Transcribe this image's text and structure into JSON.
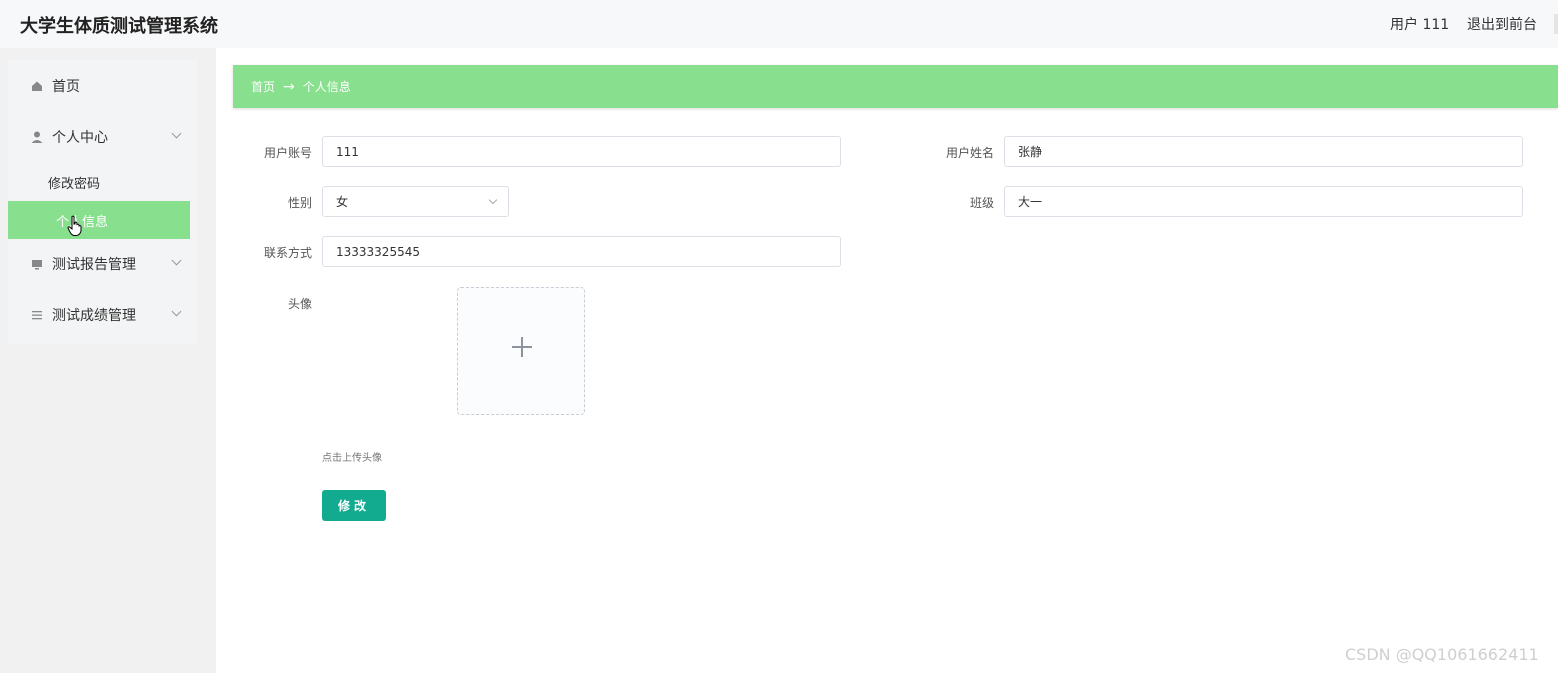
{
  "header": {
    "app_title": "大学生体质测试管理系统",
    "user_label": "用户 111",
    "exit_label": "退出到前台"
  },
  "sidebar": {
    "items": [
      {
        "label": "首页",
        "icon": "home-icon"
      },
      {
        "label": "个人中心",
        "icon": "user-icon"
      },
      {
        "label": "测试报告管理",
        "icon": "monitor-icon"
      },
      {
        "label": "测试成绩管理",
        "icon": "list-icon"
      }
    ],
    "submenu": [
      {
        "label": "修改密码"
      },
      {
        "label": "个人信息"
      }
    ]
  },
  "breadcrumb": {
    "home": "首页",
    "arrow": "→",
    "current": "个人信息"
  },
  "form": {
    "account_label": "用户账号",
    "account_value": "111",
    "name_label": "用户姓名",
    "name_value": "张静",
    "gender_label": "性别",
    "gender_value": "女",
    "class_label": "班级",
    "class_value": "大一",
    "phone_label": "联系方式",
    "phone_value": "13333325545",
    "avatar_label": "头像",
    "upload_hint": "点击上传头像",
    "submit_label": "修改"
  },
  "watermark": "CSDN @QQ1061662411",
  "colors": {
    "accent_green": "#88e08f",
    "button_teal": "#13ab8f"
  }
}
